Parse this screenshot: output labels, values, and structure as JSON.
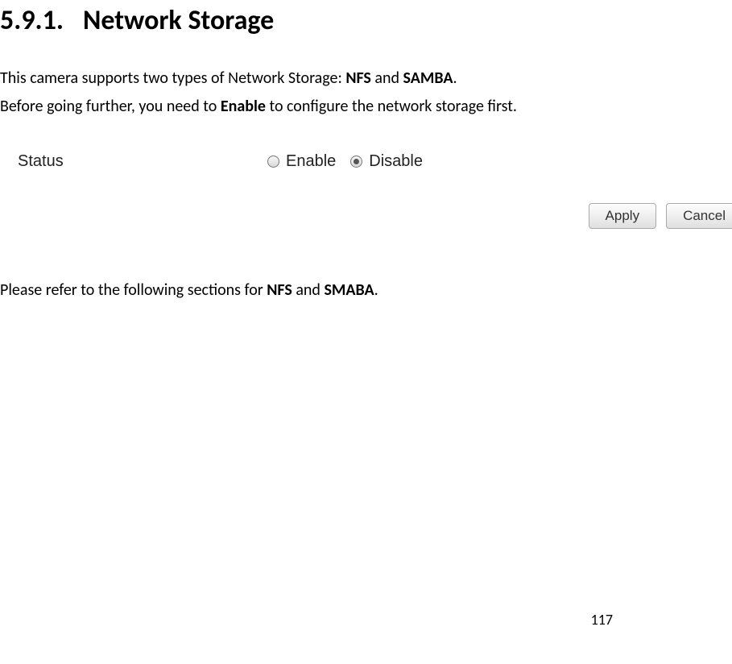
{
  "heading": {
    "number": "5.9.1.",
    "title": "Network Storage"
  },
  "intro": {
    "line1_pre": "This camera supports two types of Network Storage: ",
    "nfs": "NFS",
    "line1_mid": " and ",
    "samba": "SAMBA",
    "line1_post": ".",
    "line2_pre": "Before going further, you need to ",
    "enable": "Enable",
    "line2_post": " to configure the network storage first."
  },
  "figure": {
    "status_label": "Status",
    "enable_label": "Enable",
    "disable_label": "Disable",
    "apply_label": "Apply",
    "cancel_label": "Cancel"
  },
  "outro": {
    "pre": "Please refer to the following sections for ",
    "nfs": "NFS",
    "mid": " and ",
    "smaba": "SMABA",
    "post": "."
  },
  "page_number": "117"
}
